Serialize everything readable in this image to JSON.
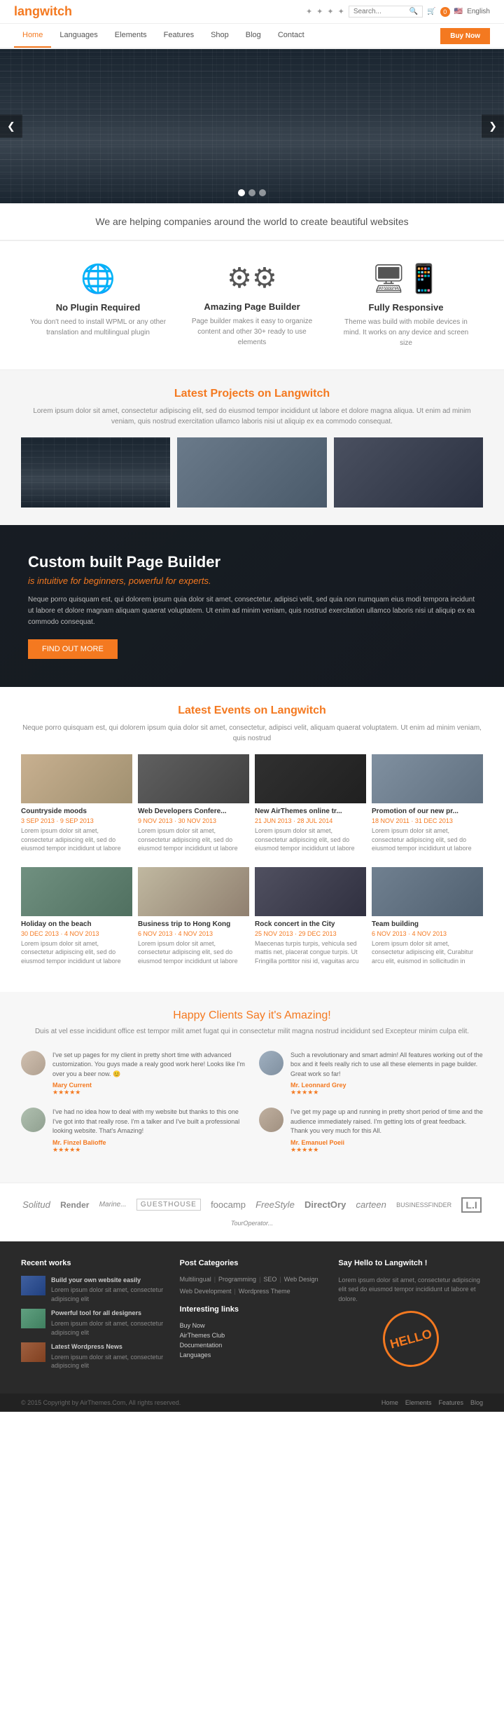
{
  "header": {
    "logo_prefix": "lang",
    "logo_accent": "witch",
    "search_placeholder": "Search...",
    "cart_count": "0",
    "language": "English"
  },
  "nav": {
    "items": [
      {
        "label": "Home",
        "active": true
      },
      {
        "label": "Languages"
      },
      {
        "label": "Elements"
      },
      {
        "label": "Features"
      },
      {
        "label": "Shop"
      },
      {
        "label": "Blog"
      },
      {
        "label": "Contact"
      }
    ],
    "buy_now": "Buy Now"
  },
  "tagline": "We are helping companies around the world to create beautiful websites",
  "features": [
    {
      "icon": "🌐",
      "title": "No Plugin Required",
      "desc": "You don't need to install WPML or any other translation and multilingual plugin"
    },
    {
      "icon": "⚙",
      "title": "Amazing Page Builder",
      "desc": "Page builder makes it easy to organize content and other 30+ ready to use elements"
    },
    {
      "icon": "🖥",
      "title": "Fully Responsive",
      "desc": "Theme was build with mobile devices in mind. It works on any device and screen size"
    }
  ],
  "projects": {
    "title": "Latest",
    "title_accent": "Projects",
    "title_suffix": "on Langwitch",
    "desc": "Lorem ipsum dolor sit amet, consectetur adipiscing elit, sed do eiusmod tempor incididunt ut labore et dolore magna aliqua. Ut enim ad minim veniam, quis nostrud exercitation ullamco laboris nisi ut aliquip ex ea commodo consequat."
  },
  "dark_banner": {
    "title": "Custom built Page Builder",
    "subtitle": "is intuitive for beginners, powerful for experts.",
    "desc": "Neque porro quisquam est, qui dolorem ipsum quia dolor sit amet, consectetur, adipisci velit, sed quia non numquam eius modi tempora incidunt ut labore et dolore magnam aliquam quaerat voluptatem. Ut enim ad minim veniam, quis nostrud exercitation ullamco laboris nisi ut aliquip ex ea commodo consequat.",
    "button": "FIND OUT MORE"
  },
  "events": {
    "title": "Latest",
    "title_accent": "Events",
    "title_suffix": "on Langwitch",
    "desc": "Neque porro quisquam est, qui dolorem ipsum quia dolor sit amet, consectetur, adipisci velit,\naliquam quaerat voluptatem. Ut enim ad minim veniam, quis nostrud",
    "items": [
      {
        "title": "Countryside moods",
        "date": "3 SEP 2013 · 9 SEP 2013",
        "desc": "Lorem ipsum dolor sit amet, consectetur adipiscing elit, sed do eiusmod tempor incididunt ut labore"
      },
      {
        "title": "Web Developers Confere...",
        "date": "9 NOV 2013 · 30 NOV 2013",
        "desc": "Lorem ipsum dolor sit amet, consectetur adipiscing elit, sed do eiusmod tempor incididunt ut labore"
      },
      {
        "title": "New AirThemes online tr...",
        "date": "21 JUN 2013 · 28 JUL 2014",
        "desc": "Lorem ipsum dolor sit amet, consectetur adipiscing elit, sed do eiusmod tempor incididunt ut labore"
      },
      {
        "title": "Promotion of our new pr...",
        "date": "18 NOV 2011 · 31 DEC 2013",
        "desc": "Lorem ipsum dolor sit amet, consectetur adipiscing elit, sed do eiusmod tempor incididunt ut labore"
      },
      {
        "title": "Holiday on the beach",
        "date": "30 DEC 2013 · 4 NOV 2013",
        "desc": "Lorem ipsum dolor sit amet, consectetur adipiscing elit, sed do eiusmod tempor incididunt ut labore"
      },
      {
        "title": "Business trip to Hong Kong",
        "date": "6 NOV 2013 · 4 NOV 2013",
        "desc": "Lorem ipsum dolor sit amet, consectetur adipiscing elit, sed do eiusmod tempor incididunt ut labore"
      },
      {
        "title": "Rock concert in the City",
        "date": "25 NOV 2013 · 29 DEC 2013",
        "desc": "Maecenas turpis turpis, vehicula sed mattis net, placerat congue turpis. Ut Fringilla porttitor nisi id, vaguitas arcu"
      },
      {
        "title": "Team building",
        "date": "6 NOV 2013 · 4 NOV 2013",
        "desc": "Lorem ipsum dolor sit amet, consectetur adipiscing elit, Curabitur arcu elit, euismod in sollicitudin in"
      }
    ]
  },
  "testimonials": {
    "title": "Happy Clients Say",
    "title_accent": "it's Amazing!",
    "desc": "Duis at vel esse incididunt office est tempor milit amet fugat qui in consectetur milit magna nostrud incididunt sed Excepteur minim culpa elit.",
    "items": [
      {
        "text": "I've set up pages for my client in pretty short time with advanced customization. You guys made a realy good work here! Looks like I'm over you a beer now. 😊",
        "name": "Mary Current",
        "stars": "★★★★★"
      },
      {
        "text": "Such a revolutionary and smart admin! All features working out of the box and it feels really rich to use all these elements in page builder. Great work so far!",
        "name": "Mr. Leonnard Grey",
        "stars": "★★★★★"
      },
      {
        "text": "I've had no idea how to deal with my website but thanks to this one I've got into that really rose. I'm a talker and I've built a professional looking website. That's Amazing!",
        "name": "Mr. Finzel Balioffe",
        "stars": "★★★★★"
      },
      {
        "text": "I've get my page up and running in pretty short period of time and the audience immediately raised. I'm getting lots of great feedback. Thank you very much for this All.",
        "name": "Mr. Emanuel Poeii",
        "stars": "★★★★★"
      }
    ]
  },
  "partners": [
    "Solitud",
    "Render",
    "Marine...",
    "GUESTHOUSE",
    "foocamp",
    "FreeStyle",
    "DirectOry",
    "carteen",
    "BUSINESSFINDER",
    "L.I",
    "TourOperator..."
  ],
  "footer": {
    "recent_works": {
      "title": "Recent works",
      "items": [
        {
          "title": "Build your own website easily",
          "desc": "Lorem ipsum dolor sit amet, consectetur adipiscing elit"
        },
        {
          "title": "Powerful tool for all designers",
          "desc": "Lorem ipsum dolor sit amet, consectetur adipiscing elit"
        },
        {
          "title": "Latest Wordpress News",
          "desc": "Lorem ipsum dolor sit amet, consectetur adipiscing elit"
        }
      ]
    },
    "post_categories": {
      "title": "Post Categories",
      "cats": [
        "Multilingual",
        "Programming",
        "SEO",
        "Web Design",
        "Web Development",
        "Wordpress Theme"
      ],
      "interesting_links_title": "Interesting links",
      "links": [
        "Buy Now",
        "AirThemes Club",
        "Documentation",
        "Languages"
      ]
    },
    "hello": {
      "title": "Say Hello to Langwitch !",
      "desc": "Lorem ipsum dolor sit amet, consectetur adipiscing elit sed do eiusmod tempor incididunt ut labore et dolore.",
      "stamp": "HELLO"
    },
    "bottom": {
      "copy": "© 2015 Copyright by AirThemes.Com, All rights reserved.",
      "nav": [
        "Home",
        "Elements",
        "Features",
        "Blog"
      ]
    }
  }
}
